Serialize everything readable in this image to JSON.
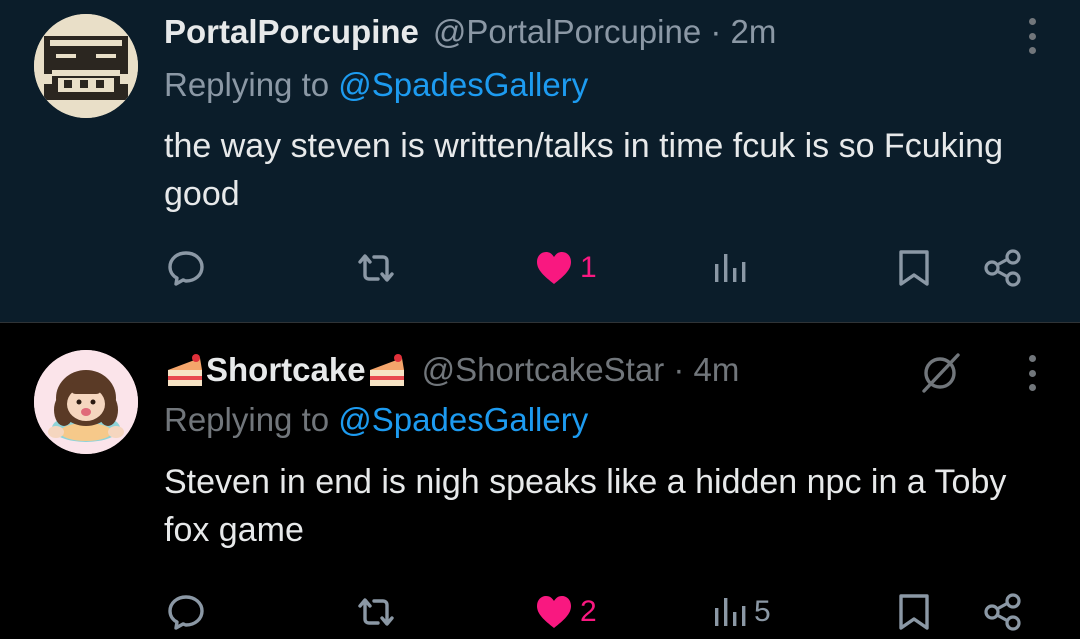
{
  "tweets": [
    {
      "display_name": "PortalPorcupine",
      "handle_time": "@PortalPorcupine · 2m",
      "replying_prefix": "Replying to ",
      "replying_to": "@SpadesGallery",
      "text": "the way steven is written/talks in time fcuk is so Fcuking good",
      "likes": "1",
      "views": ""
    },
    {
      "display_name": "Shortcake",
      "handle_time": "@ShortcakeStar · 4m",
      "replying_prefix": "Replying to ",
      "replying_to": "@SpadesGallery",
      "text": "Steven in end is nigh speaks like a hidden npc in a Toby fox game",
      "likes": "2",
      "views": "5"
    }
  ],
  "icons": {
    "reply": "speech-bubble-icon",
    "retweet": "retweet-arrows-icon",
    "like": "heart-icon",
    "views": "bar-chart-icon",
    "bookmark": "bookmark-icon",
    "share": "share-icon",
    "more": "vertical-dots-icon",
    "grok": "grok-icon",
    "emoji": "cake-slice-emoji"
  },
  "colors": {
    "highlight_bg": "#0b1d2a",
    "bg": "#000000",
    "text": "#e7e9ea",
    "secondary": "#8b98a5",
    "accent_blue": "#1d9bf0",
    "like_pink": "#f91880"
  }
}
